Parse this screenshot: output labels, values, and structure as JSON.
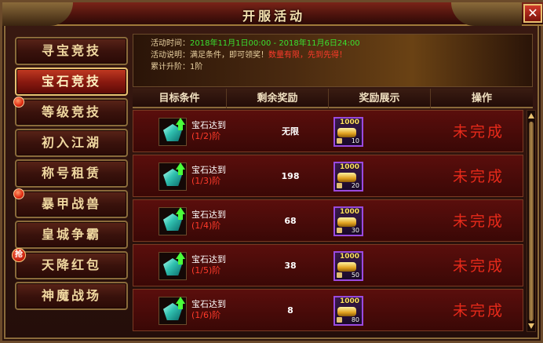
{
  "window": {
    "title": "开服活动",
    "close_label": "✕"
  },
  "sidebar": {
    "items": [
      {
        "label": "寻宝竞技",
        "active": false,
        "badge": ""
      },
      {
        "label": "宝石竞技",
        "active": true,
        "badge": ""
      },
      {
        "label": "等级竞技",
        "active": false,
        "badge": "dot"
      },
      {
        "label": "初入江湖",
        "active": false,
        "badge": ""
      },
      {
        "label": "称号租赁",
        "active": false,
        "badge": ""
      },
      {
        "label": "暴甲战兽",
        "active": false,
        "badge": "dot"
      },
      {
        "label": "皇城争霸",
        "active": false,
        "badge": ""
      },
      {
        "label": "天降红包",
        "active": false,
        "badge": "抢"
      },
      {
        "label": "神魔战场",
        "active": false,
        "badge": ""
      }
    ]
  },
  "info": {
    "time_label": "活动时间：",
    "time_value": "2018年11月1日00:00 - 2018年11月6日24:00",
    "desc_label": "活动说明：满足条件，即可领奖！",
    "desc_warn": "数量有限，先到先得！",
    "progress_label": "累计升阶：1阶"
  },
  "table": {
    "headers": [
      "目标条件",
      "剩余奖励",
      "奖励展示",
      "操作"
    ],
    "rows": [
      {
        "cond_main": "宝石达到",
        "cond_sub": "(1/2)阶",
        "remaining": "无限",
        "gold": "1000",
        "qty": "10",
        "status": "未完成"
      },
      {
        "cond_main": "宝石达到",
        "cond_sub": "(1/3)阶",
        "remaining": "198",
        "gold": "1000",
        "qty": "20",
        "status": "未完成"
      },
      {
        "cond_main": "宝石达到",
        "cond_sub": "(1/4)阶",
        "remaining": "68",
        "gold": "1000",
        "qty": "30",
        "status": "未完成"
      },
      {
        "cond_main": "宝石达到",
        "cond_sub": "(1/5)阶",
        "remaining": "38",
        "gold": "1000",
        "qty": "50",
        "status": "未完成"
      },
      {
        "cond_main": "宝石达到",
        "cond_sub": "(1/6)阶",
        "remaining": "8",
        "gold": "1000",
        "qty": "80",
        "status": "未完成"
      }
    ]
  },
  "colors": {
    "accent_gold": "#e8c070",
    "status_red": "#e82a1a",
    "green": "#3ae030"
  }
}
